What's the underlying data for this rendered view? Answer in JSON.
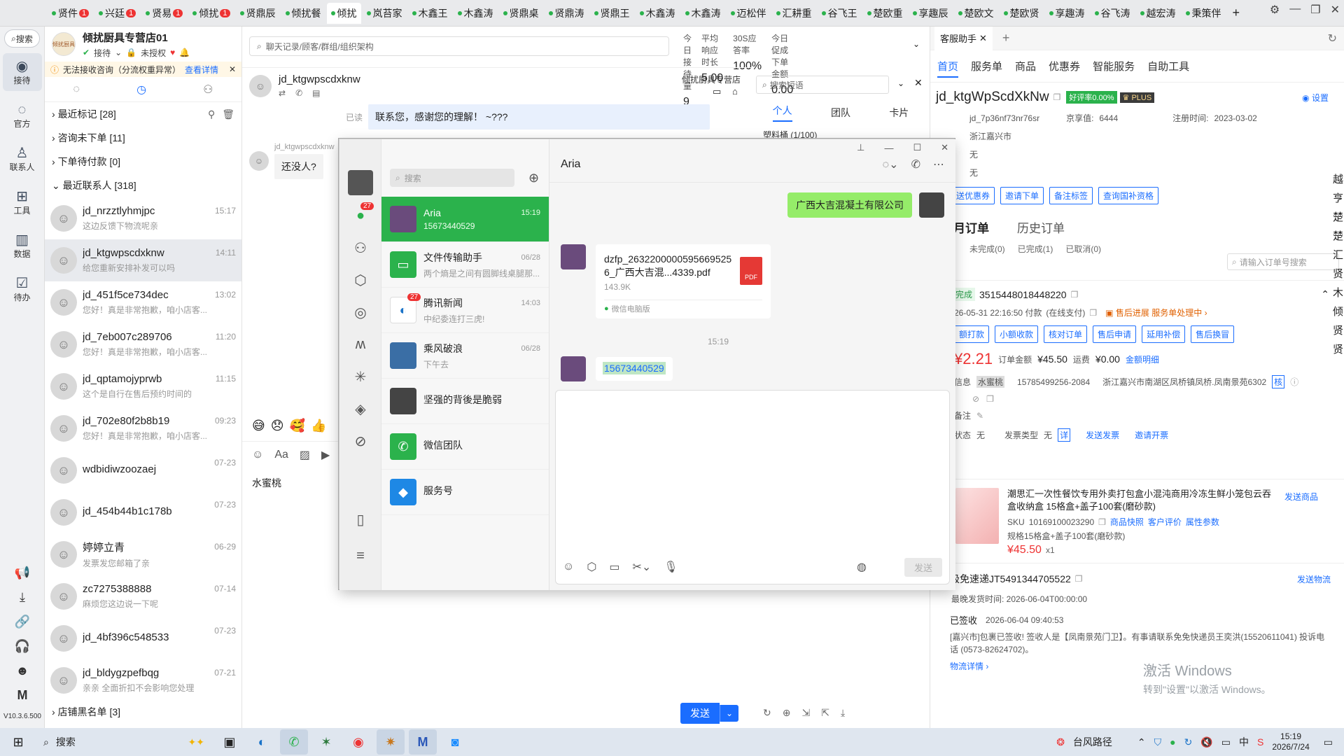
{
  "tabs": [
    {
      "label": "贤件",
      "badge": "1"
    },
    {
      "label": "兴廷",
      "badge": "1"
    },
    {
      "label": "贤易",
      "badge": "1"
    },
    {
      "label": "倾扰",
      "badge": "1"
    },
    {
      "label": "贤鼎辰"
    },
    {
      "label": "倾扰餐"
    },
    {
      "label": "倾扰",
      "active": true
    },
    {
      "label": "岚苔家"
    },
    {
      "label": "木鑫王"
    },
    {
      "label": "木鑫涛"
    },
    {
      "label": "贤鼎桌"
    },
    {
      "label": "贤鼎涛"
    },
    {
      "label": "贤鼎王"
    },
    {
      "label": "木鑫涛"
    },
    {
      "label": "木鑫涛"
    },
    {
      "label": "迈松伴"
    },
    {
      "label": "汇耕重"
    },
    {
      "label": "谷飞王"
    },
    {
      "label": "楚欧重"
    },
    {
      "label": "享趣辰"
    },
    {
      "label": "楚欧文"
    },
    {
      "label": "楚欧贤"
    },
    {
      "label": "享趣涛"
    },
    {
      "label": "谷飞涛"
    },
    {
      "label": "越宏涛"
    },
    {
      "label": "秉策伴"
    }
  ],
  "leftnav": {
    "search": "搜索",
    "items": [
      {
        "label": "接待",
        "icon": "◉"
      },
      {
        "label": "官方",
        "icon": "◌"
      },
      {
        "label": "联系人",
        "icon": "♙"
      },
      {
        "label": "工具",
        "icon": "⊞"
      },
      {
        "label": "数据",
        "icon": "▥"
      },
      {
        "label": "待办",
        "icon": "☑"
      }
    ],
    "version": "V10.3.6.500"
  },
  "shop": {
    "name": "倾扰厨具专营店01",
    "status": "接待",
    "auth": "未授权",
    "logo": "倾扰厨具",
    "warning": "无法接收咨询（分流权重异常）",
    "warning_link": "查看详情"
  },
  "groups": {
    "marked": "最近标记 [28]",
    "unordered": "咨询未下单 [11]",
    "unpaid": "下单待付款 [0]",
    "recent": "最近联系人 [318]",
    "blacklist": "店铺黑名单 [3]"
  },
  "conversations": [
    {
      "name": "jd_nrzztlyhmjpc",
      "time": "15:17",
      "preview": "这边反馈下物流呢亲"
    },
    {
      "name": "jd_ktgwpscdxknw",
      "time": "14:11",
      "preview": "给您重新安排补发可以吗",
      "selected": true
    },
    {
      "name": "jd_451f5ce734dec",
      "time": "13:02",
      "preview": "您好！真是非常抱歉，咱小店客..."
    },
    {
      "name": "jd_7eb007c289706",
      "time": "11:20",
      "preview": "您好！真是非常抱歉，咱小店客..."
    },
    {
      "name": "jd_qptamojyprwb",
      "time": "11:15",
      "preview": "这个是自行在售后预约时间的"
    },
    {
      "name": "jd_702e80f2b8b19",
      "time": "09:23",
      "preview": "您好！真是非常抱歉，咱小店客..."
    },
    {
      "name": "wdbidiwzoozaej",
      "time": "07-23",
      "preview": ""
    },
    {
      "name": "jd_454b44b1c178b",
      "time": "07-23",
      "preview": ""
    },
    {
      "name": "婷婷立青",
      "time": "06-29",
      "preview": "发票发您邮箱了亲"
    },
    {
      "name": "zc7275388888",
      "time": "07-14",
      "preview": "麻烦您这边说一下呢"
    },
    {
      "name": "jd_4bf396c548533",
      "time": "07-23",
      "preview": ""
    },
    {
      "name": "jd_bldygzpefbqg",
      "time": "07-21",
      "preview": "亲亲 全面折扣不会影响您处理"
    }
  ],
  "chat": {
    "search": "聊天记录/顾客/群组/组织架构",
    "stats": [
      {
        "label": "今日接待量",
        "value": "9"
      },
      {
        "label": "平均响应时长",
        "value": "5.00"
      },
      {
        "label": "30S应答率",
        "value": "100%"
      },
      {
        "label": "今日促成下单金额",
        "value": "0.00"
      }
    ],
    "contact": "jd_ktgwpscdxknw",
    "shop_tag": "倾扰厨具专营店",
    "read": "已读",
    "msg_out": "联系您，感谢您的理解！ ~???",
    "sender": "jd_ktgwpscdxknw",
    "msg_in": "还没人?",
    "input_text": "水蜜桃",
    "send": "发送",
    "quick_search": "搜索短语",
    "qtabs": [
      "个人",
      "团队",
      "卡片"
    ],
    "qgroup": "塑料桶 (1/100)"
  },
  "wechat": {
    "search": "搜索",
    "chat_title": "Aria",
    "contacts": [
      {
        "name": "Aria",
        "time": "15:19",
        "preview": "15673440529",
        "selected": true,
        "color": "#6a4b7c"
      },
      {
        "name": "文件传输助手",
        "time": "06/28",
        "preview": "两个熵是之间有圆脚线桌腿那...",
        "color": "#2bb24c",
        "icon": "▭"
      },
      {
        "name": "腾讯新闻",
        "time": "14:03",
        "preview": "中纪委连打三虎!",
        "color": "#fff",
        "badge": "27",
        "icon": "◐"
      },
      {
        "name": "乘风破浪",
        "time": "06/28",
        "preview": "下午去",
        "color": "#3a6ea5"
      },
      {
        "name": "坚强的背後是脆弱",
        "time": "",
        "preview": "",
        "color": "#444"
      },
      {
        "name": "微信团队",
        "time": "",
        "preview": "",
        "color": "#2bb24c",
        "icon": "✆"
      },
      {
        "name": "服务号",
        "time": "",
        "preview": "",
        "color": "#1e88e5",
        "icon": "◆"
      }
    ],
    "side_badge": "27",
    "company": "广西大吉混凝土有限公司",
    "file": {
      "name": "dzfp_26322000005956695256_广西大吉混...4339.pdf",
      "size": "143.9K",
      "source": "微信电脑版",
      "badge": "PDF"
    },
    "timestamp": "15:19",
    "phone": "15673440529",
    "send": "发送"
  },
  "helper": {
    "tab": "客服助手",
    "nav": [
      "首页",
      "服务单",
      "商品",
      "优惠券",
      "智能服务",
      "自助工具"
    ],
    "settings": "设置",
    "user": "jd_ktgWpScdXkNw",
    "rate": "好评率0.00%",
    "plus": "PLUS",
    "pin": "jd_7p36nf73nr76sr",
    "score_label": "京享值:",
    "score": "6444",
    "reg_label": "注册时间:",
    "reg": "2023-03-02",
    "region": "浙江嘉兴市",
    "f1": "无",
    "f2": "无",
    "buttons": [
      "送优惠券",
      "邀请下单",
      "备注标签",
      "查询国补资格"
    ],
    "order_tabs": [
      "个月订单",
      "历史订单"
    ],
    "order_counts": [
      "未完成(0)",
      "已完成(1)",
      "已取消(0)"
    ],
    "order_search": "请输入订单号搜索",
    "order": {
      "status": "完成",
      "id": "3515448018448220",
      "time": "26-05-31 22:16:50 付款",
      "pay": "(在线支付)",
      "after": "售后进展",
      "after2": "服务单处理中",
      "actions": [
        "额打款",
        "小额收款",
        "核对订单",
        "售后申请",
        "延用补偿",
        "售后换冒"
      ],
      "price": "¥2.21",
      "total_label": "订单金额",
      "total": "¥45.50",
      "ship_label": "运费",
      "ship": "¥0.00",
      "detail": "金额明细",
      "recv_label": "信息",
      "recv": "水蜜桃",
      "phone": "15785499256-2084",
      "addr": "浙江嘉兴市南湖区凤桥镇凤桥.凤南景苑6302",
      "check": "核",
      "note": "备注",
      "inv_label": "状态",
      "inv": "无",
      "inv_type_label": "发票类型",
      "inv_type": "无",
      "inv_detail": "详",
      "send_inv": "发送发票",
      "invite_inv": "邀请开票"
    },
    "product": {
      "title": "潮思汇一次性餐饮专用外卖打包盒小混沌商用冷冻生鲜小笼包云吞盒收纳盒 15格盒+盖子100套(磨砂款)",
      "send": "发送商品",
      "sku_label": "SKU",
      "sku": "10169100023290",
      "links": [
        "商品快照",
        "客户评价",
        "属性参数"
      ],
      "spec": "规格15格盒+盖子100套(磨砂款)",
      "price": "¥45.50",
      "qty": "x1"
    },
    "logistics": {
      "company": "极免速递",
      "no": "JT5491344705522",
      "send": "发送物流",
      "ship_time": "最晚发货时间:  2026-06-04T00:00:00",
      "signed": "已签收",
      "signed_time": "2026-06-04 09:40:53",
      "detail": "[嘉兴市]包裹已签收! 签收人是【凤南景苑门卫】。有事请联系免免快递员王奕洪(15520611041) 投诉电话 (0573-82624702)。",
      "more": "物流详情"
    },
    "watermark1": "激活 Windows",
    "watermark2": "转到\"设置\"以激活 Windows。",
    "edge": [
      "越",
      "亨",
      "楚",
      "楚",
      "汇",
      "贤",
      "木",
      "倾",
      "贤",
      "贤"
    ]
  },
  "taskbar": {
    "search": "搜索",
    "weather": "台风路径",
    "time": "15:19",
    "date": "2026/7/24",
    "ime": "中"
  }
}
